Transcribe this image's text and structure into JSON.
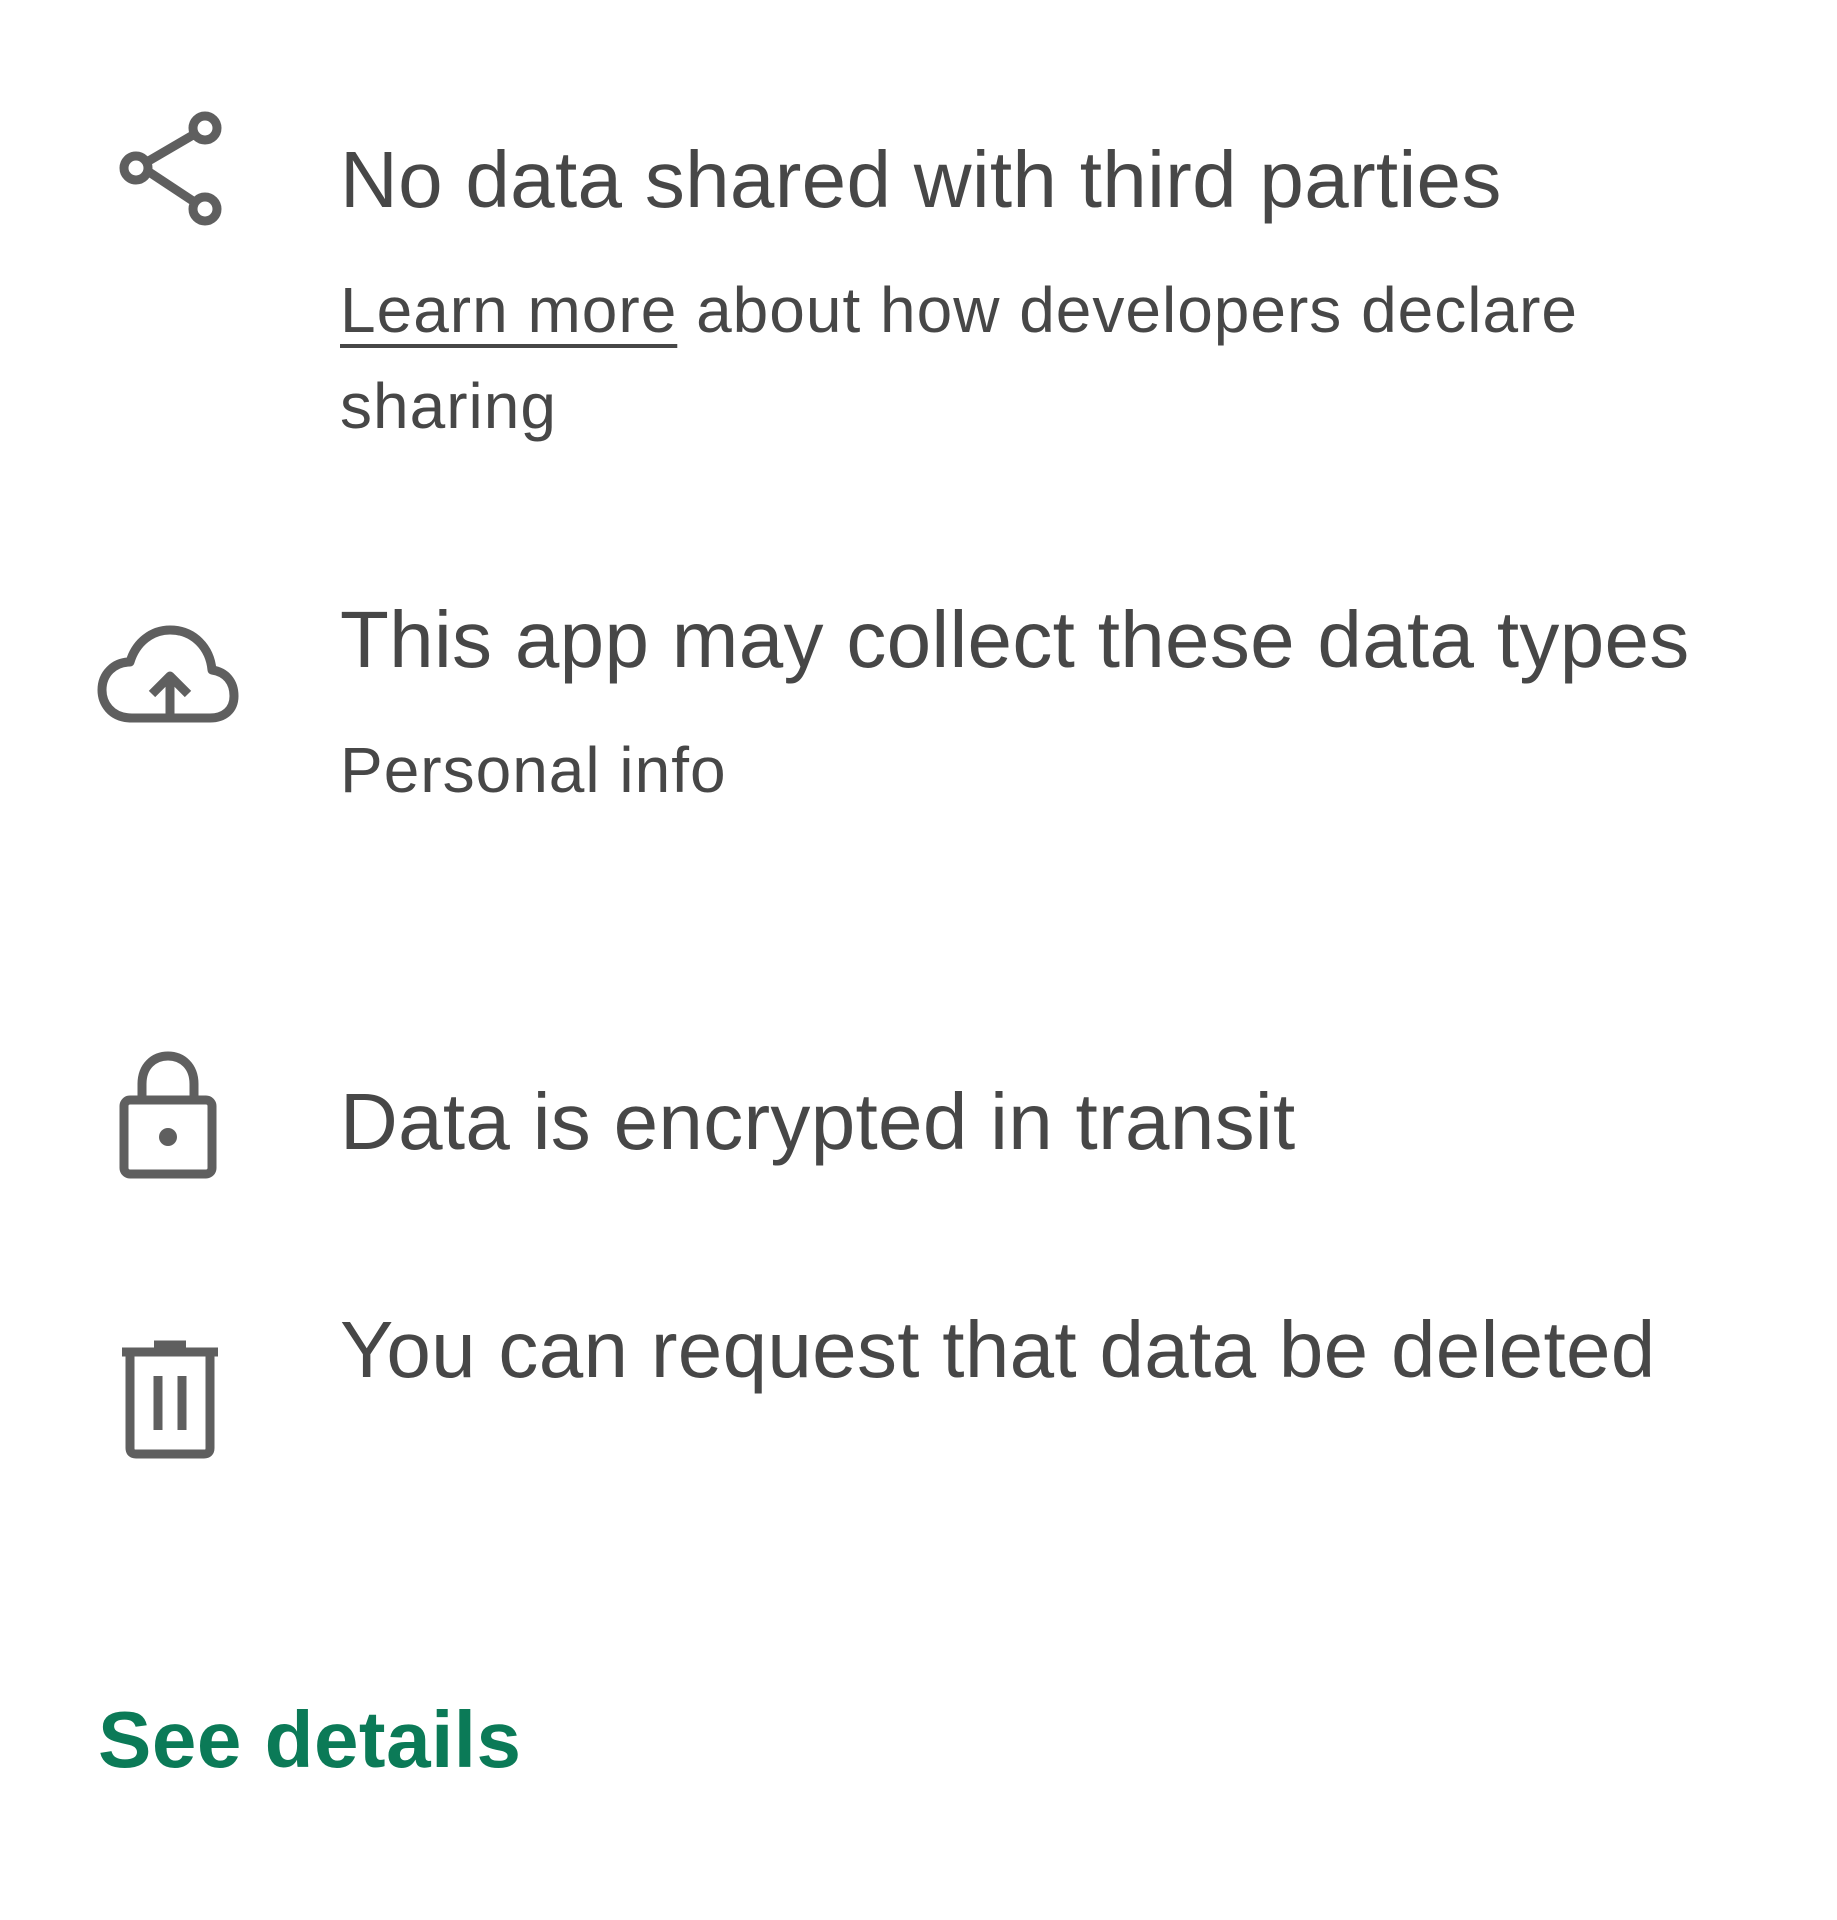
{
  "items": [
    {
      "icon": "share-icon",
      "title": "No data shared with third parties",
      "sub_link": "Learn more",
      "sub_rest": " about how developers declare sharing"
    },
    {
      "icon": "cloud-upload-icon",
      "title": "This app may collect these data types",
      "sub": "Personal info"
    },
    {
      "icon": "lock-icon",
      "title": "Data is encrypted in transit"
    },
    {
      "icon": "trash-icon",
      "title": "You can request that data be deleted"
    }
  ],
  "footer": {
    "see_details_label": "See details"
  },
  "colors": {
    "text": "#474747",
    "icon": "#5f5f5f",
    "accent": "#0b7a57"
  }
}
